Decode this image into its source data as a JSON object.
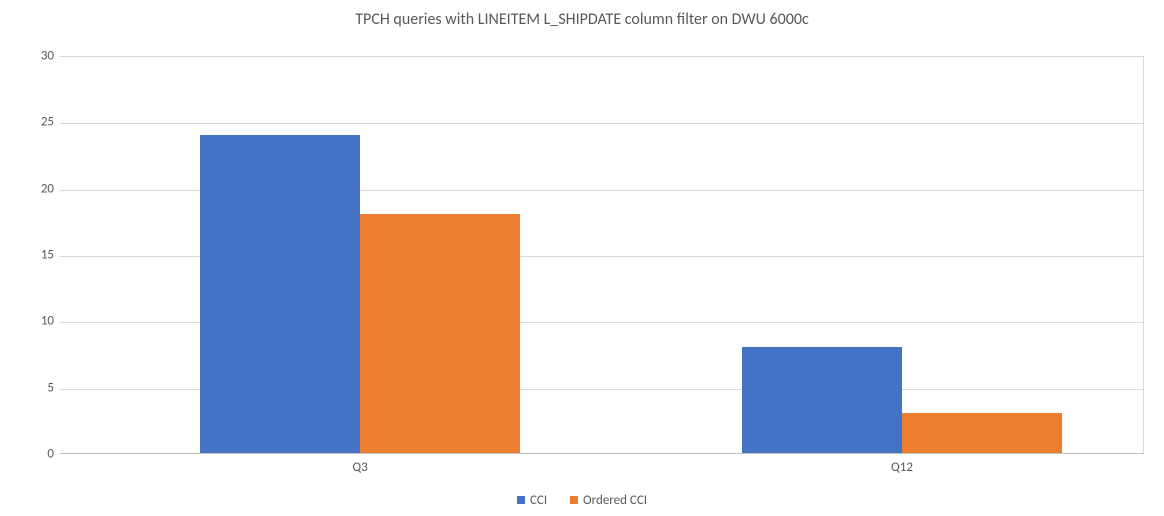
{
  "chart_data": {
    "type": "bar",
    "title": "TPCH queries with LINEITEM L_SHIPDATE column filter on DWU 6000c",
    "categories": [
      "Q3",
      "Q12"
    ],
    "series": [
      {
        "name": "CCI",
        "values": [
          24,
          8
        ],
        "color": "#4472c4"
      },
      {
        "name": "Ordered CCI",
        "values": [
          18,
          3
        ],
        "color": "#ed7d31"
      }
    ],
    "ylim": [
      0,
      30
    ],
    "ystep": 5,
    "xlabel": "",
    "ylabel": ""
  }
}
